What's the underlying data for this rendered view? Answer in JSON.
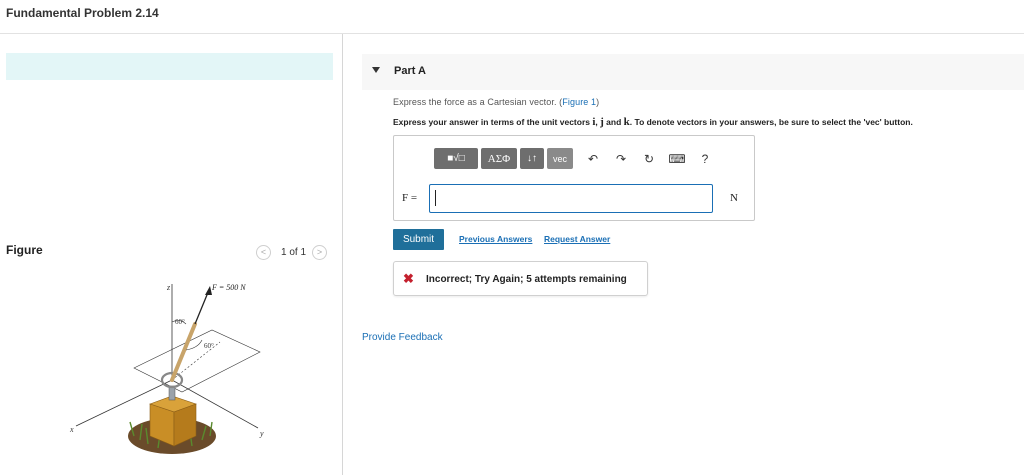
{
  "header": {
    "title": "Fundamental Problem 2.14"
  },
  "figure_panel": {
    "label": "Figure",
    "pager": {
      "prev": "<",
      "count": "1 of 1",
      "next": ">"
    },
    "figure": {
      "force_label": "F = 500 N",
      "angle_z": "60°",
      "angle_y": "60°",
      "axis_x": "x",
      "axis_y": "y",
      "axis_z": "z"
    }
  },
  "part": {
    "title": "Part A"
  },
  "question": {
    "prompt_prefix": "Express the force as a Cartesian vector. (",
    "figure_link": "Figure 1",
    "prompt_suffix": ")",
    "instruction_prefix": "Express your answer in terms of the unit vectors ",
    "unit_i": "i",
    "sep1": ", ",
    "unit_j": "j",
    "sep2": " and ",
    "unit_k": "k",
    "instruction_suffix": ". To denote vectors in your answers, be sure to select the 'vec' button."
  },
  "answer": {
    "toolbar": {
      "templates": "■√□",
      "greek": "ΑΣΦ",
      "sort": "↓↑",
      "vec": "vec",
      "undo": "↶",
      "redo": "↷",
      "reset": "↻",
      "keyboard": "⌨",
      "help": "?"
    },
    "variable": "F =",
    "value": "",
    "unit": "N"
  },
  "actions": {
    "submit": "Submit",
    "previous_answers": "Previous Answers",
    "request_answer": "Request Answer"
  },
  "feedback": {
    "icon": "✖",
    "message": "Incorrect; Try Again; 5 attempts remaining"
  },
  "footer": {
    "provide_feedback": "Provide Feedback"
  },
  "colors": {
    "accent": "#1a6fb5",
    "submit_bg": "#1f6f9a",
    "error": "#c4202e",
    "banner": "#e3f6f7"
  }
}
